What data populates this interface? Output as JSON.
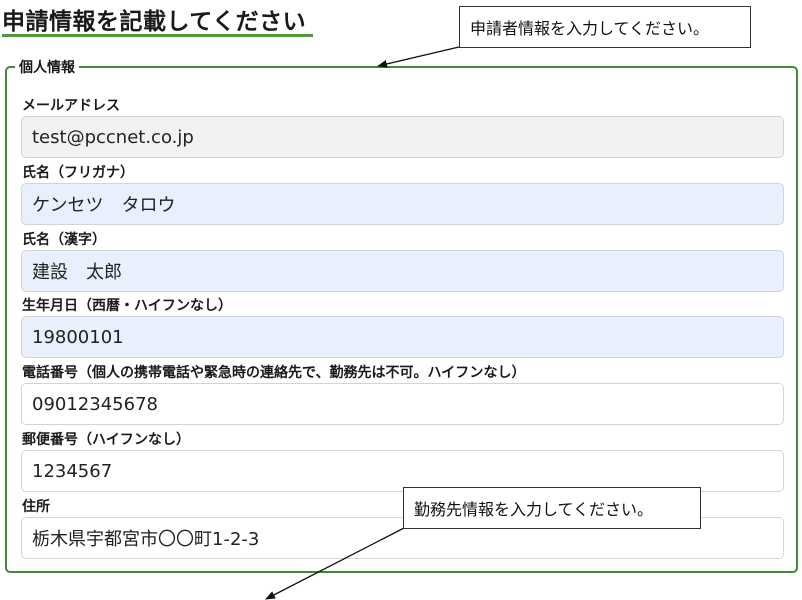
{
  "page": {
    "title": "申請情報を記載してください"
  },
  "personal_info": {
    "legend": "個人情報",
    "fields": [
      {
        "label": "メールアドレス",
        "value": "test@pccnet.co.jp"
      },
      {
        "label": "氏名（フリガナ）",
        "value": "ケンセツ　タロウ"
      },
      {
        "label": "氏名（漢字）",
        "value": "建設　太郎"
      },
      {
        "label": "生年月日（西暦・ハイフンなし）",
        "value": "19800101"
      },
      {
        "label": "電話番号（個人の携帯電話や緊急時の連絡先で、勤務先は不可。ハイフンなし）",
        "value": "09012345678"
      },
      {
        "label": "郵便番号（ハイフンなし）",
        "value": "1234567"
      },
      {
        "label": "住所",
        "value": "栃木県宇都宮市〇〇町1-2-3"
      }
    ]
  },
  "annotations": {
    "applicant_note": "申請者情報を入力してください。",
    "employer_note": "勤務先情報を入力してください。"
  },
  "colors": {
    "accent_green": "#3c8d2f",
    "underline_green": "#4aa02c",
    "autofill_blue": "#e8f0fe",
    "readonly_gray": "#f2f2f2"
  }
}
